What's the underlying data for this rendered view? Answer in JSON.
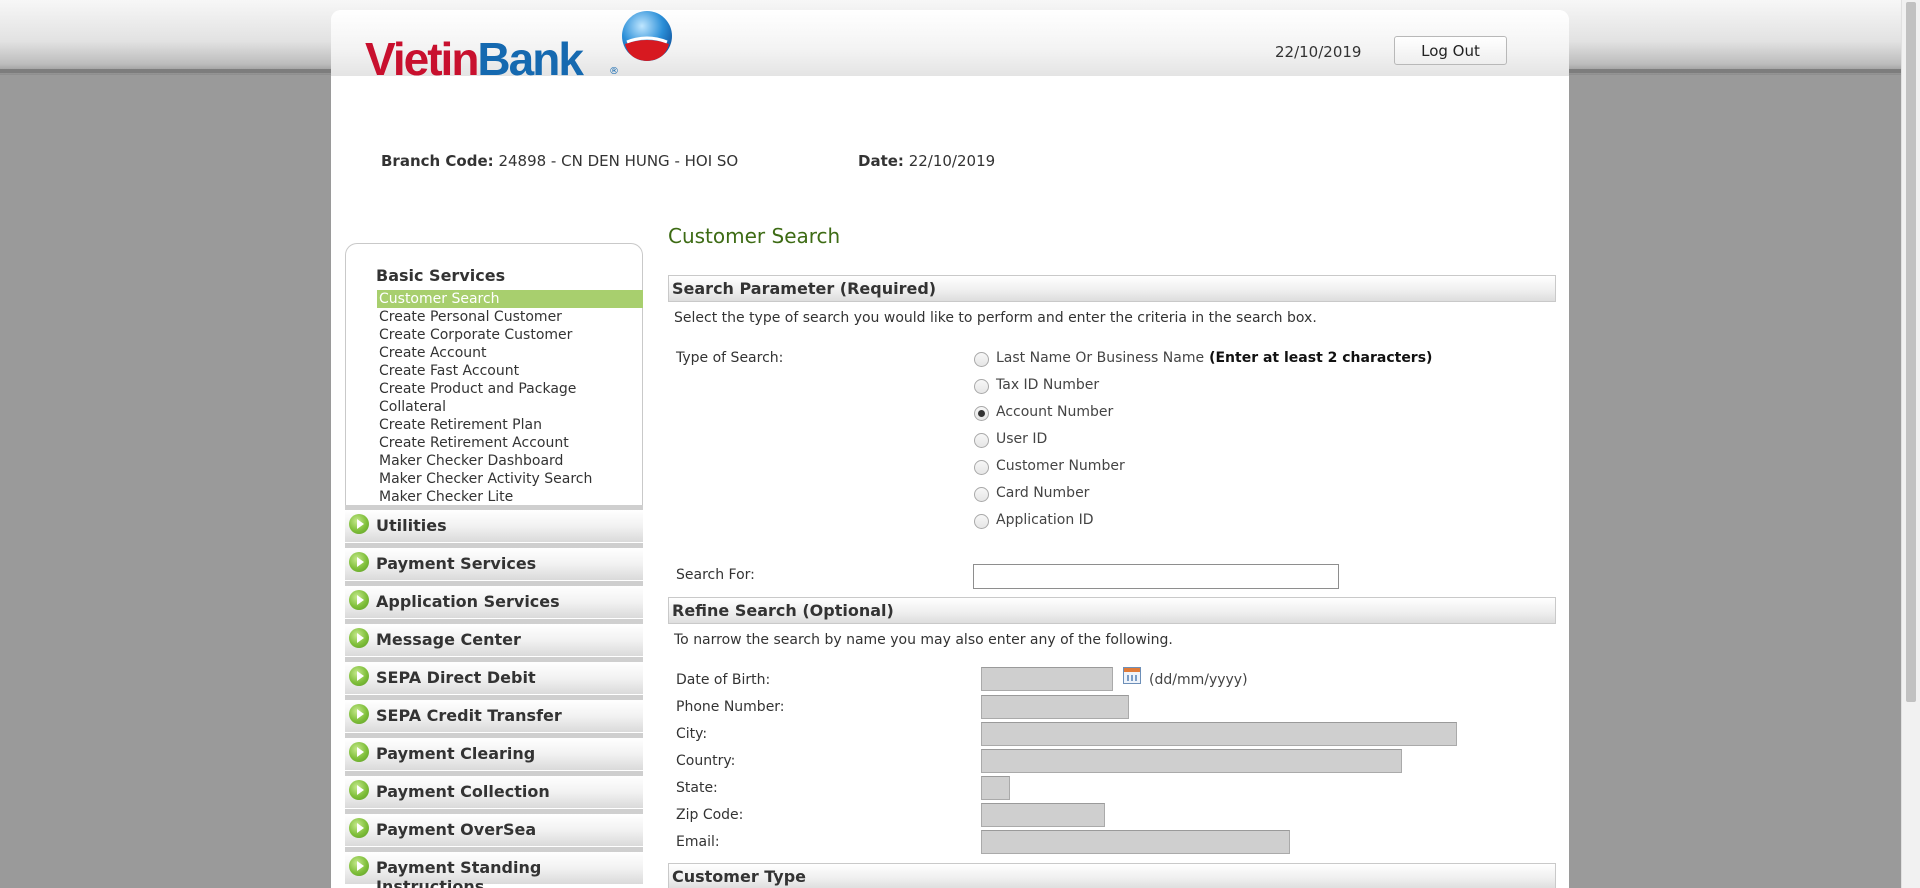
{
  "header": {
    "logo_text_1": "Vietin",
    "logo_text_2": "Bank",
    "logo_reg": "®",
    "date": "22/10/2019",
    "logout_label": "Log Out"
  },
  "info": {
    "branch_label": "Branch Code:",
    "branch_value": "24898 - CN DEN HUNG - HOI SO",
    "date_label": "Date:",
    "date_value": "22/10/2019"
  },
  "sidebar": {
    "basic_title": "Basic Services",
    "links": [
      {
        "label": "Customer Search",
        "active": true
      },
      {
        "label": "Create Personal Customer"
      },
      {
        "label": "Create Corporate Customer"
      },
      {
        "label": "Create Account"
      },
      {
        "label": "Create Fast Account"
      },
      {
        "label": "Create Product and Package"
      },
      {
        "label": "Collateral"
      },
      {
        "label": "Create Retirement Plan"
      },
      {
        "label": "Create Retirement Account"
      },
      {
        "label": "Maker Checker Dashboard"
      },
      {
        "label": "Maker Checker Activity Search"
      },
      {
        "label": "Maker Checker Lite"
      }
    ],
    "sections": [
      "Utilities",
      "Payment Services",
      "Application Services",
      "Message Center",
      "SEPA Direct Debit",
      "SEPA Credit Transfer",
      "Payment Clearing",
      "Payment Collection",
      "Payment OverSea",
      "Payment Standing Instructions"
    ]
  },
  "main": {
    "page_title": "Customer Search",
    "search_param_header": "Search Parameter (Required)",
    "search_param_desc": "Select the type of search you would like to perform and enter the criteria in the search box.",
    "type_of_search_label": "Type of Search:",
    "search_types": [
      {
        "label": "Last Name Or Business Name",
        "hint": "(Enter at least 2 characters)",
        "checked": false
      },
      {
        "label": "Tax ID Number",
        "checked": false
      },
      {
        "label": "Account Number",
        "checked": true
      },
      {
        "label": "User ID",
        "checked": false
      },
      {
        "label": "Customer Number",
        "checked": false
      },
      {
        "label": "Card Number",
        "checked": false
      },
      {
        "label": "Application ID",
        "checked": false
      }
    ],
    "search_for_label": "Search For:",
    "search_for_value": "",
    "refine_header": "Refine Search (Optional)",
    "refine_desc": "To narrow the search by name you may also enter any of the following.",
    "dob_label": "Date of Birth:",
    "dob_hint": "(dd/mm/yyyy)",
    "phone_label": "Phone Number:",
    "city_label": "City:",
    "country_label": "Country:",
    "state_label": "State:",
    "zip_label": "Zip Code:",
    "email_label": "Email:",
    "customer_type_header": "Customer Type"
  }
}
